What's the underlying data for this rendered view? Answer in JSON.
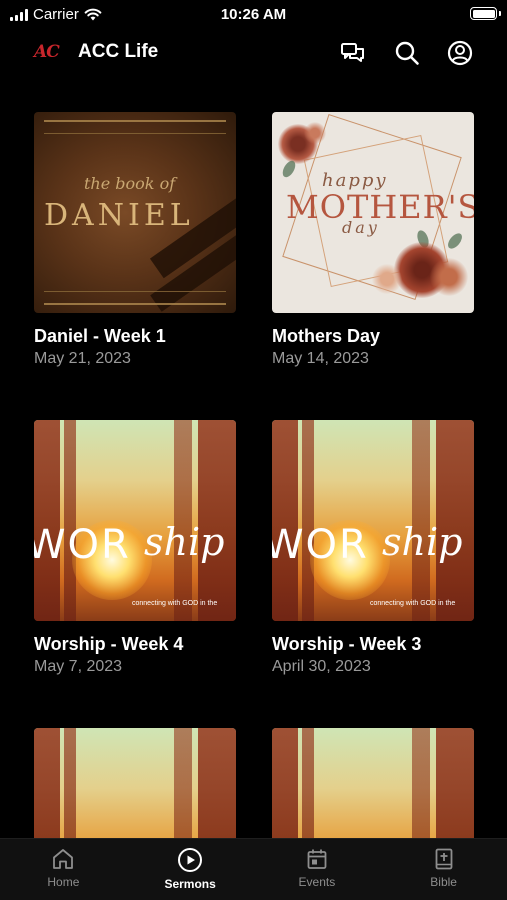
{
  "status_bar": {
    "carrier": "Carrier",
    "time": "10:26 AM"
  },
  "header": {
    "logo": "AC",
    "title": "ACC Life",
    "accent_color": "#c8262c"
  },
  "sermons": [
    {
      "title": "Daniel - Week 1",
      "date": "May 21, 2023",
      "artwork": {
        "small": "the book of",
        "big": "DANIEL"
      }
    },
    {
      "title": "Mothers Day",
      "date": "May 14, 2023",
      "artwork": {
        "happy": "happy",
        "big": "MOTHER'S",
        "day": "day"
      }
    },
    {
      "title": "Worship - Week 4",
      "date": "May 7, 2023",
      "artwork": {
        "w1": "WOR",
        "w2": "ship",
        "tag": "connecting with GOD in the"
      }
    },
    {
      "title": "Worship - Week 3",
      "date": "April 30, 2023",
      "artwork": {
        "w1": "WOR",
        "w2": "ship",
        "tag": "connecting with GOD in the"
      }
    }
  ],
  "tabs": [
    {
      "label": "Home",
      "icon": "home-icon",
      "active": false
    },
    {
      "label": "Sermons",
      "icon": "play-circle-icon",
      "active": true
    },
    {
      "label": "Events",
      "icon": "calendar-icon",
      "active": false
    },
    {
      "label": "Bible",
      "icon": "bible-icon",
      "active": false
    }
  ]
}
